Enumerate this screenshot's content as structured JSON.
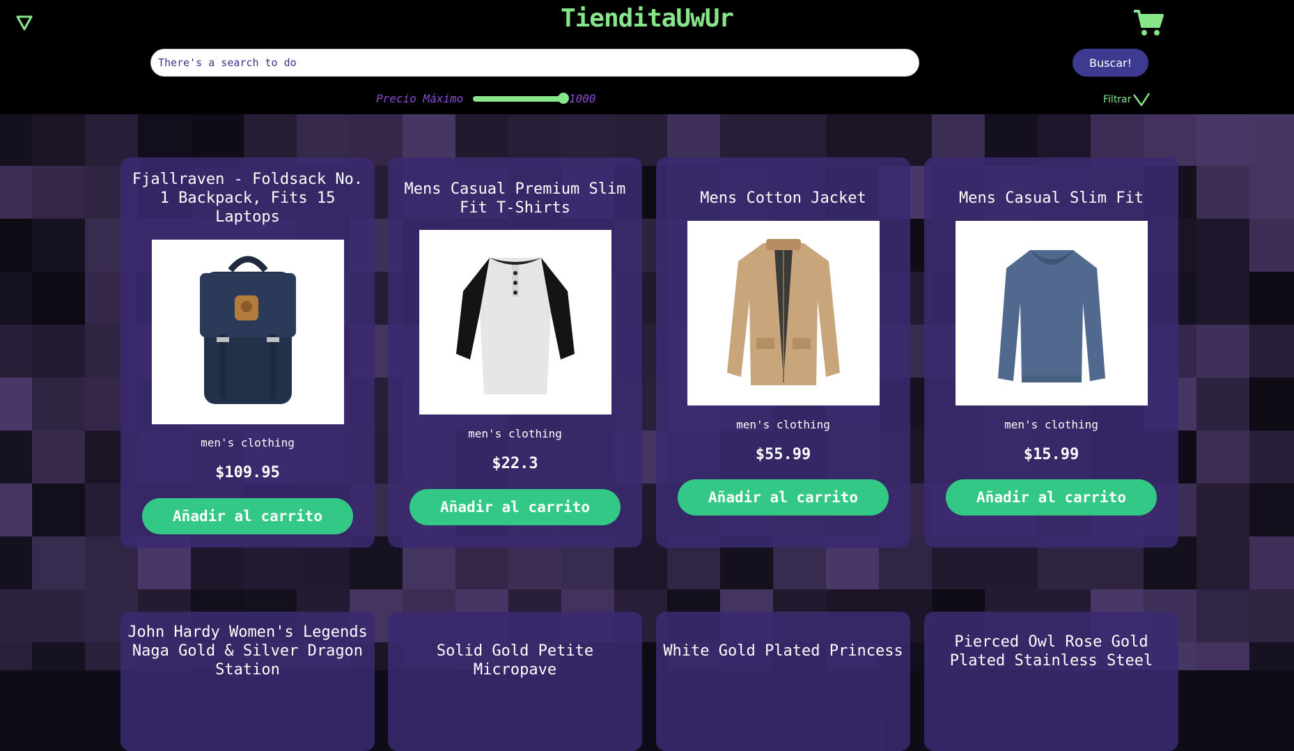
{
  "header": {
    "brand": "TienditaUwUr",
    "search_placeholder": "There's a search to do",
    "search_button": "Buscar!",
    "price_label": "Precio Máximo",
    "price_value": "1000",
    "price_fraction": 1.0,
    "filter_label": "Filtrar"
  },
  "icons": {
    "menu": "triangle-down-icon",
    "cart": "cart-icon",
    "filter": "chevron-down-icon"
  },
  "colors": {
    "accent_green": "#86e689",
    "button_green": "#33c885",
    "card_purple": "#3a2a70",
    "search_button": "#3e3a92",
    "price_label": "#8a4cd6"
  },
  "products": [
    {
      "title": "Fjallraven - Foldsack No. 1 Backpack, Fits 15 Laptops",
      "category": "men's clothing",
      "price": "$109.95",
      "button": "Añadir al carrito",
      "image": "backpack"
    },
    {
      "title": "Mens Casual Premium Slim Fit T-Shirts",
      "category": "men's clothing",
      "price": "$22.3",
      "button": "Añadir al carrito",
      "image": "tshirt"
    },
    {
      "title": "Mens Cotton Jacket",
      "category": "men's clothing",
      "price": "$55.99",
      "button": "Añadir al carrito",
      "image": "jacket"
    },
    {
      "title": "Mens Casual Slim Fit",
      "category": "men's clothing",
      "price": "$15.99",
      "button": "Añadir al carrito",
      "image": "longsleeve"
    },
    {
      "title": "John Hardy Women's Legends Naga Gold & Silver Dragon Station",
      "category": "",
      "price": "",
      "button": "",
      "image": ""
    },
    {
      "title": "Solid Gold Petite Micropave",
      "category": "",
      "price": "",
      "button": "",
      "image": ""
    },
    {
      "title": "White Gold Plated Princess",
      "category": "",
      "price": "",
      "button": "",
      "image": ""
    },
    {
      "title": "Pierced Owl Rose Gold Plated Stainless Steel",
      "category": "",
      "price": "",
      "button": "",
      "image": ""
    }
  ]
}
